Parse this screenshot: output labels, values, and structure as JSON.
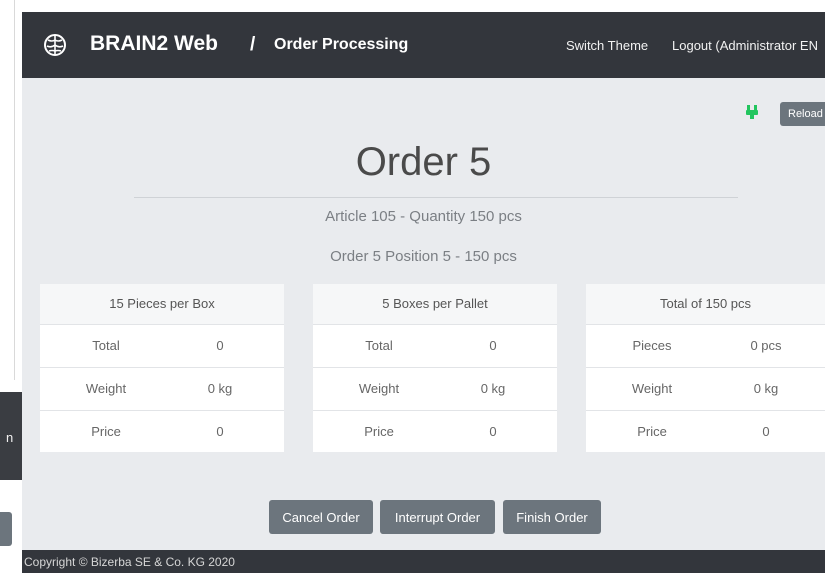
{
  "bg_window": {
    "partial_label": "n"
  },
  "navbar": {
    "brand": "BRAIN2 Web",
    "separator": "/",
    "page": "Order Processing",
    "links": {
      "switch_theme": "Switch Theme",
      "logout": "Logout (Administrator EN"
    },
    "brand_icon": "brain-icon"
  },
  "toolbar": {
    "reload_label": "Reload",
    "status_icon": "plug-connected-icon",
    "status_color": "#22c55e"
  },
  "order": {
    "title": "Order 5",
    "article_line": "Article 105 - Quantity 150 pcs",
    "position_line": "Order 5 Position 5 - 150 pcs"
  },
  "cards": [
    {
      "header": "15 Pieces per Box",
      "rows": [
        {
          "label": "Total",
          "value": "0"
        },
        {
          "label": "Weight",
          "value": "0 kg"
        },
        {
          "label": "Price",
          "value": "0"
        }
      ]
    },
    {
      "header": "5 Boxes per Pallet",
      "rows": [
        {
          "label": "Total",
          "value": "0"
        },
        {
          "label": "Weight",
          "value": "0 kg"
        },
        {
          "label": "Price",
          "value": "0"
        }
      ]
    },
    {
      "header": "Total of 150 pcs",
      "rows": [
        {
          "label": "Pieces",
          "value": "0 pcs"
        },
        {
          "label": "Weight",
          "value": "0 kg"
        },
        {
          "label": "Price",
          "value": "0"
        }
      ]
    }
  ],
  "actions": {
    "cancel": "Cancel Order",
    "interrupt": "Interrupt Order",
    "finish": "Finish Order"
  },
  "footer": {
    "copyright": "Copyright © Bizerba SE & Co. KG 2020"
  },
  "colors": {
    "navbar": "#33363c",
    "background": "#e9ebee",
    "button": "#6c757d"
  }
}
